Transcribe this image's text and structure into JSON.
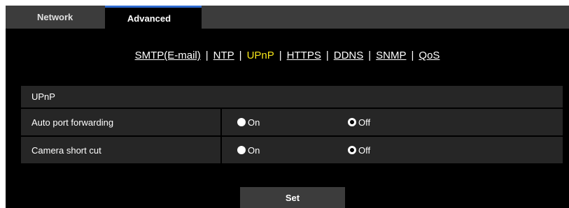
{
  "tabs": [
    {
      "label": "Network",
      "active": false
    },
    {
      "label": "Advanced",
      "active": true
    }
  ],
  "subnav": {
    "links": [
      {
        "label": "SMTP(E-mail)",
        "active": false
      },
      {
        "label": "NTP",
        "active": false
      },
      {
        "label": "UPnP",
        "active": true
      },
      {
        "label": "HTTPS",
        "active": false
      },
      {
        "label": "DDNS",
        "active": false
      },
      {
        "label": "SNMP",
        "active": false
      },
      {
        "label": "QoS",
        "active": false
      }
    ],
    "separator": "|"
  },
  "section": {
    "title": "UPnP"
  },
  "settings": [
    {
      "label": "Auto port forwarding",
      "on_label": "On",
      "off_label": "Off",
      "selected": "Off"
    },
    {
      "label": "Camera short cut",
      "on_label": "On",
      "off_label": "Off",
      "selected": "Off"
    }
  ],
  "set_button": {
    "label": "Set"
  },
  "colors": {
    "background": "#000000",
    "panel": "#262626",
    "tab_bar": "#3c3c3c",
    "active_link": "#f5e51a",
    "active_tab_accent": "#2f6bd0"
  }
}
